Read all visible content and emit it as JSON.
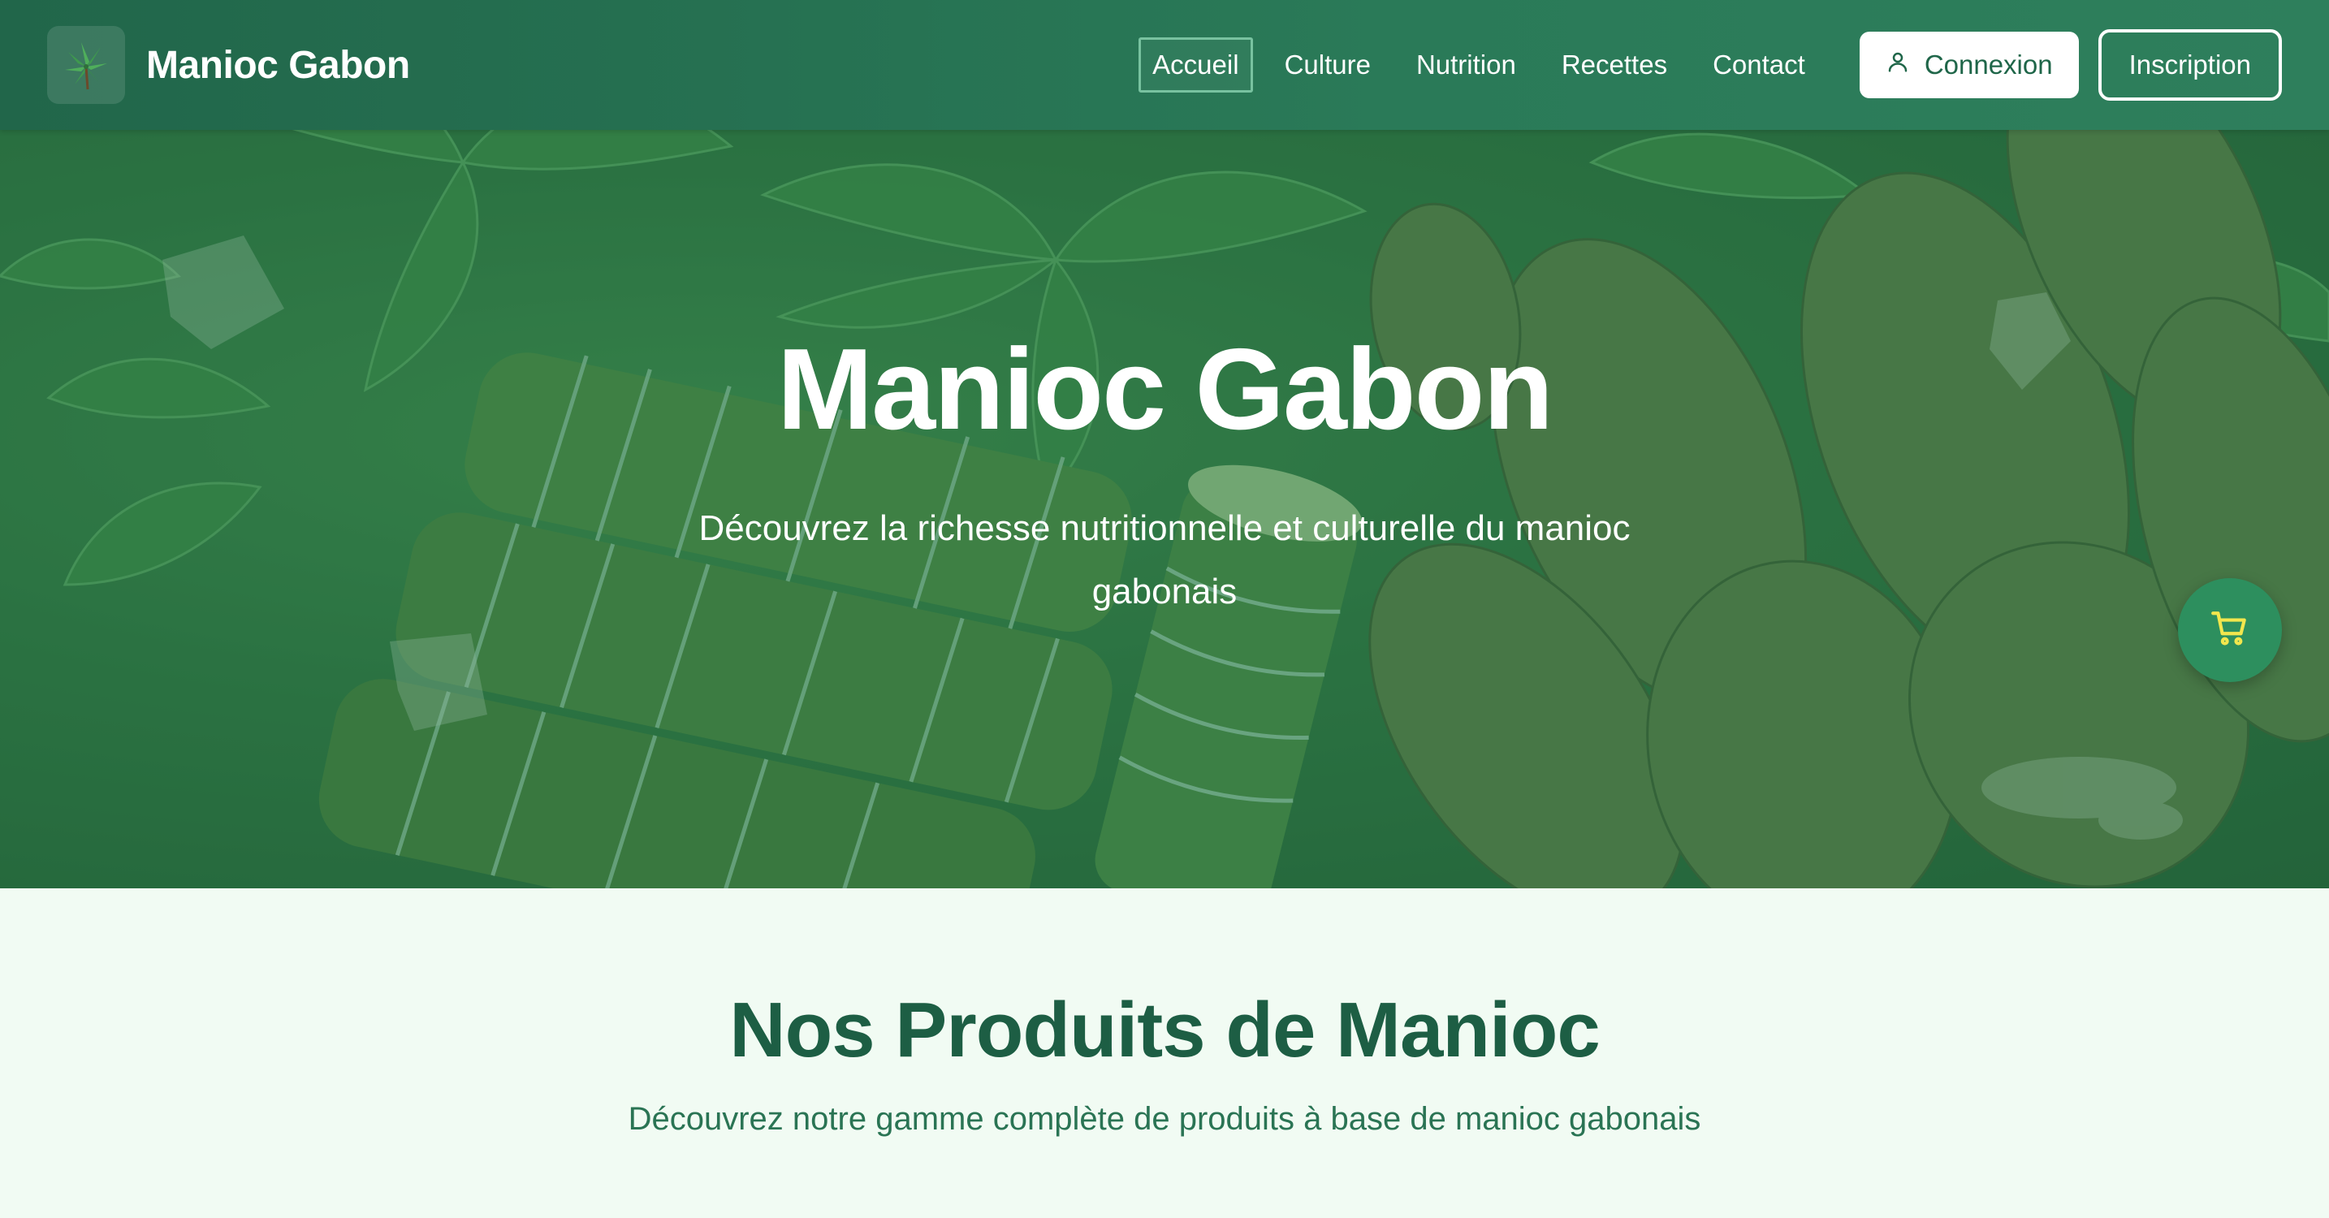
{
  "brand": {
    "name": "Manioc Gabon",
    "logo_icon": "cassava-plant-icon"
  },
  "nav": {
    "links": [
      {
        "label": "Accueil",
        "active": true
      },
      {
        "label": "Culture",
        "active": false
      },
      {
        "label": "Nutrition",
        "active": false
      },
      {
        "label": "Recettes",
        "active": false
      },
      {
        "label": "Contact",
        "active": false
      }
    ],
    "login_label": "Connexion",
    "login_icon": "user-icon",
    "signup_label": "Inscription"
  },
  "hero": {
    "title": "Manioc Gabon",
    "subtitle": "Découvrez la richesse nutritionnelle et culturelle du manioc gabonais",
    "cart_icon": "shopping-cart-icon"
  },
  "products": {
    "title": "Nos Produits de Manioc",
    "subtitle": "Découvrez notre gamme complète de produits à base de manioc gabonais"
  },
  "colors": {
    "nav_bg": "#21664a",
    "accent": "#2d8f5e",
    "heading": "#1d5e44",
    "section_bg": "#f1fbf3"
  }
}
